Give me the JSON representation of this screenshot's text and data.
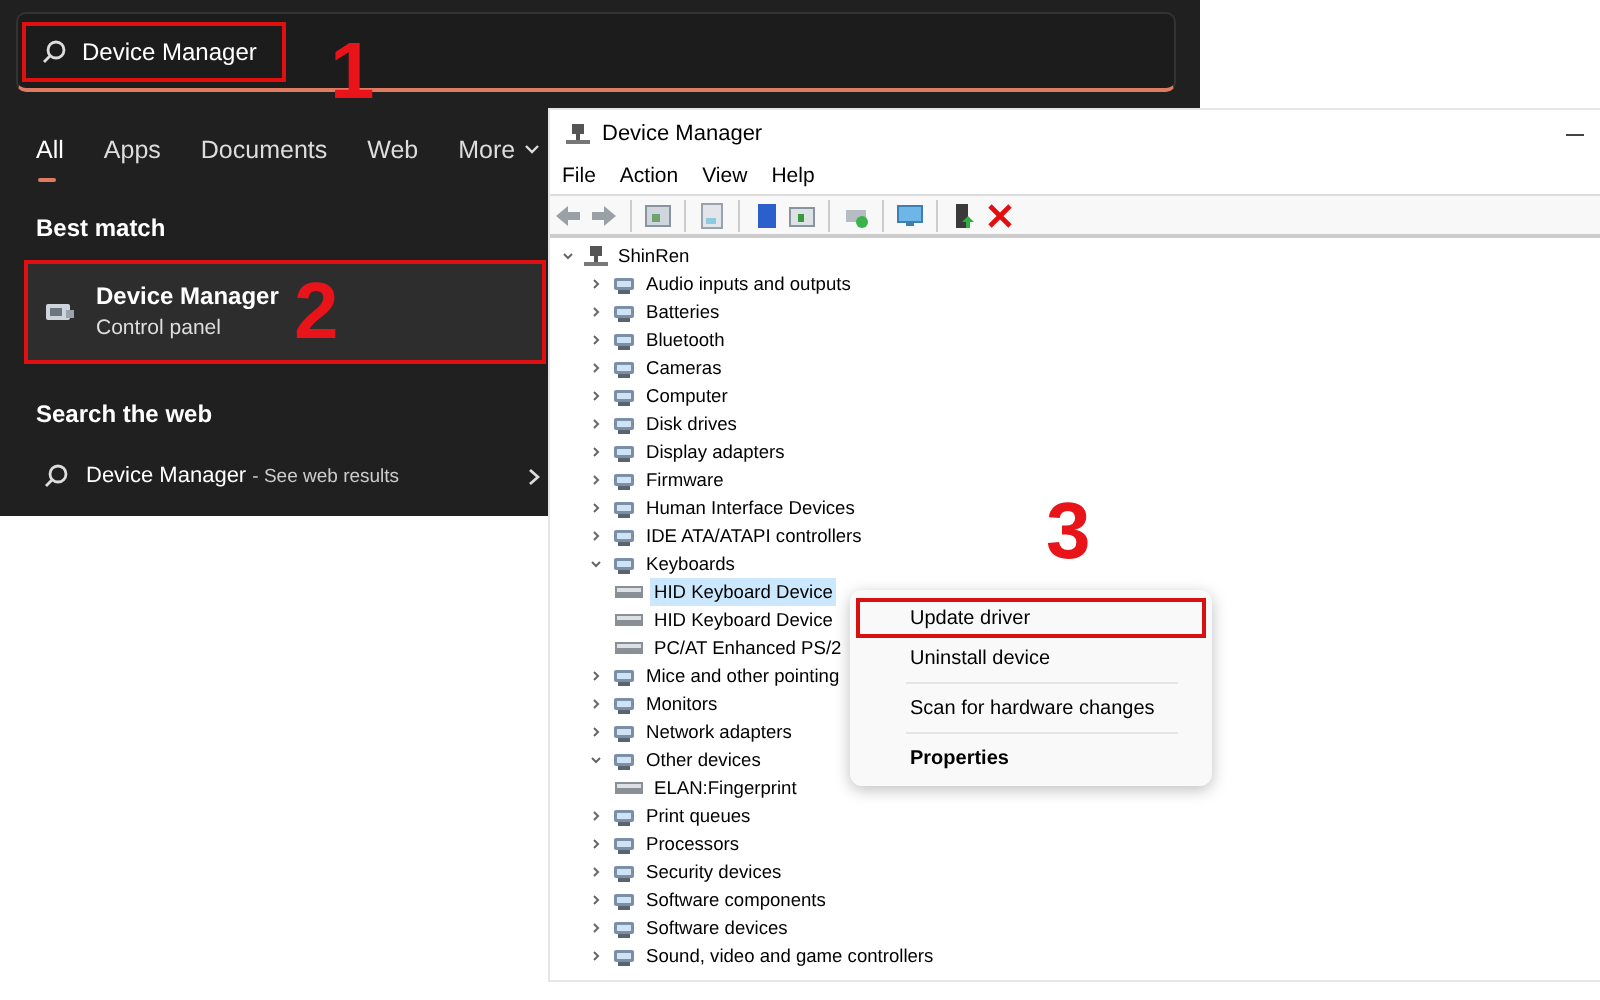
{
  "search_panel": {
    "search_field": {
      "value": "Device Manager",
      "highlighted": true
    },
    "filters": [
      {
        "label": "All",
        "selected": true,
        "dropdown": false
      },
      {
        "label": "Apps",
        "selected": false,
        "dropdown": false
      },
      {
        "label": "Documents",
        "selected": false,
        "dropdown": false
      },
      {
        "label": "Web",
        "selected": false,
        "dropdown": false
      },
      {
        "label": "More",
        "selected": false,
        "dropdown": true
      }
    ],
    "best_match": {
      "heading": "Best match",
      "title": "Device Manager",
      "subtitle": "Control panel",
      "highlighted": true
    },
    "web": {
      "heading": "Search the web",
      "query": "Device Manager",
      "hint": "- See web results"
    }
  },
  "device_manager": {
    "title": "Device Manager",
    "menu": [
      "File",
      "Action",
      "View",
      "Help"
    ],
    "tree": [
      {
        "label": "ShinRen",
        "expanded": true,
        "selected": false,
        "children": [
          {
            "label": "Audio inputs and outputs",
            "expanded": false,
            "selected": false
          },
          {
            "label": "Batteries",
            "expanded": false,
            "selected": false
          },
          {
            "label": "Bluetooth",
            "expanded": false,
            "selected": false
          },
          {
            "label": "Cameras",
            "expanded": false,
            "selected": false
          },
          {
            "label": "Computer",
            "expanded": false,
            "selected": false
          },
          {
            "label": "Disk drives",
            "expanded": false,
            "selected": false
          },
          {
            "label": "Display adapters",
            "expanded": false,
            "selected": false
          },
          {
            "label": "Firmware",
            "expanded": false,
            "selected": false
          },
          {
            "label": "Human Interface Devices",
            "expanded": false,
            "selected": false
          },
          {
            "label": "IDE ATA/ATAPI controllers",
            "expanded": false,
            "selected": false
          },
          {
            "label": "Keyboards",
            "expanded": true,
            "selected": false,
            "children": [
              {
                "label": "HID Keyboard Device",
                "selected": true
              },
              {
                "label": "HID Keyboard Device",
                "selected": false
              },
              {
                "label": "PC/AT Enhanced PS/2",
                "selected": false
              }
            ]
          },
          {
            "label": "Mice and other pointing",
            "expanded": false,
            "selected": false
          },
          {
            "label": "Monitors",
            "expanded": false,
            "selected": false
          },
          {
            "label": "Network adapters",
            "expanded": false,
            "selected": false
          },
          {
            "label": "Other devices",
            "expanded": true,
            "selected": false,
            "children": [
              {
                "label": "ELAN:Fingerprint",
                "selected": false
              }
            ]
          },
          {
            "label": "Print queues",
            "expanded": false,
            "selected": false
          },
          {
            "label": "Processors",
            "expanded": false,
            "selected": false
          },
          {
            "label": "Security devices",
            "expanded": false,
            "selected": false
          },
          {
            "label": "Software components",
            "expanded": false,
            "selected": false
          },
          {
            "label": "Software devices",
            "expanded": false,
            "selected": false
          },
          {
            "label": "Sound, video and game controllers",
            "expanded": false,
            "selected": false
          }
        ]
      }
    ],
    "context_menu": [
      {
        "label": "Update driver",
        "bold": false,
        "highlighted": true,
        "separator_after": false
      },
      {
        "label": "Uninstall device",
        "bold": false,
        "highlighted": false,
        "separator_after": true
      },
      {
        "label": "Scan for hardware changes",
        "bold": false,
        "highlighted": false,
        "separator_after": true
      },
      {
        "label": "Properties",
        "bold": true,
        "highlighted": false,
        "separator_after": false
      }
    ]
  },
  "annotations": [
    {
      "label": "1"
    },
    {
      "label": "2"
    },
    {
      "label": "3"
    }
  ]
}
